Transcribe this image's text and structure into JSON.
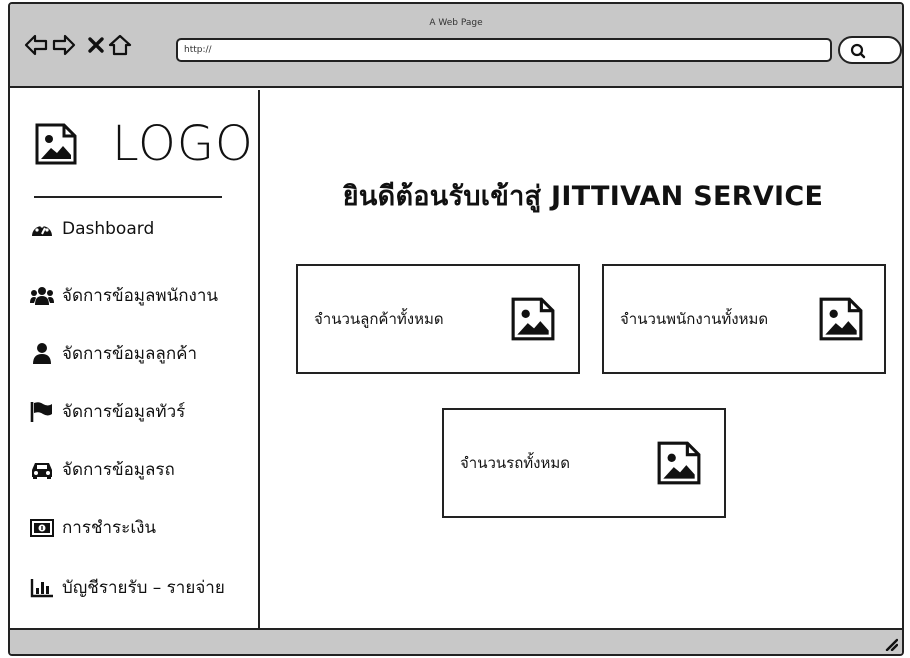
{
  "browser": {
    "title": "A Web Page",
    "url": "http://",
    "icons": [
      "back-arrow-icon",
      "forward-arrow-icon",
      "close-icon",
      "home-icon",
      "search-icon"
    ]
  },
  "sidebar": {
    "logo_text": "LOGO",
    "items": [
      {
        "label": "Dashboard",
        "icon": "tachometer-icon"
      },
      {
        "label": "จัดการข้อมูลพนักงาน",
        "icon": "users-icon"
      },
      {
        "label": "จัดการข้อมูลลูกค้า",
        "icon": "user-icon"
      },
      {
        "label": "จัดการข้อมูลทัวร์",
        "icon": "flag-icon"
      },
      {
        "label": "จัดการข้อมูลรถ",
        "icon": "car-icon"
      },
      {
        "label": "การชำระเงิน",
        "icon": "money-icon"
      },
      {
        "label": "บัญชีรายรับ – รายจ่าย",
        "icon": "bar-chart-icon"
      }
    ]
  },
  "main": {
    "welcome": "ยินดีต้อนรับเข้าสู่ JITTIVAN SERVICE",
    "cards": [
      {
        "label": "จำนวนลูกค้าทั้งหมด",
        "icon": "image-icon"
      },
      {
        "label": "จำนวนพนักงานทั้งหมด",
        "icon": "image-icon"
      },
      {
        "label": "จำนวนรถทั้งหมด",
        "icon": "image-icon"
      }
    ]
  },
  "colors": {
    "chrome": "#c8c8c8",
    "stroke": "#222222",
    "background": "#ffffff"
  }
}
